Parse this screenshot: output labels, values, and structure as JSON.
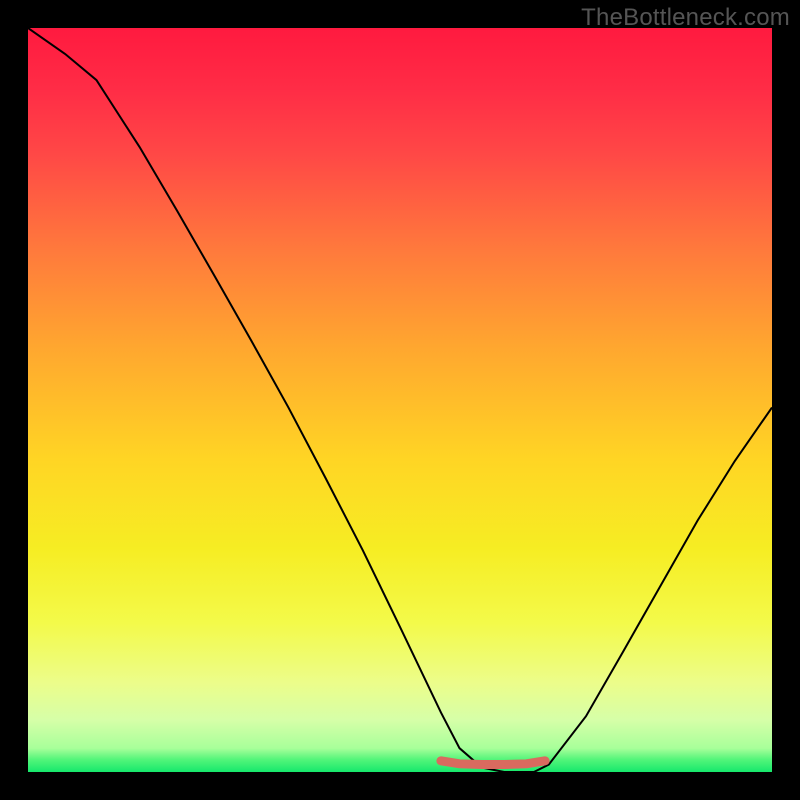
{
  "watermark": "TheBottleneck.com",
  "colors": {
    "gradient_stops": [
      {
        "offset": 0.0,
        "color": "#ff1a3f"
      },
      {
        "offset": 0.085,
        "color": "#ff2d46"
      },
      {
        "offset": 0.17,
        "color": "#ff4846"
      },
      {
        "offset": 0.3,
        "color": "#ff7a3c"
      },
      {
        "offset": 0.43,
        "color": "#ffa72f"
      },
      {
        "offset": 0.58,
        "color": "#ffd524"
      },
      {
        "offset": 0.7,
        "color": "#f6ed23"
      },
      {
        "offset": 0.8,
        "color": "#f3fa4a"
      },
      {
        "offset": 0.88,
        "color": "#ecfd8a"
      },
      {
        "offset": 0.93,
        "color": "#d6ffa8"
      },
      {
        "offset": 0.968,
        "color": "#a8ff9a"
      },
      {
        "offset": 0.983,
        "color": "#54f57a"
      },
      {
        "offset": 1.0,
        "color": "#16e86c"
      }
    ],
    "curve": "#000000",
    "marker": "#d96a5f",
    "frame_bg": "#000000"
  },
  "chart_data": {
    "type": "line",
    "title": "",
    "xlabel": "",
    "ylabel": "",
    "notes": "Bottleneck curve chart. Axes have no visible tick labels. x is normalized 0..1 across width, y is normalized 0..1 (0 = bottom / no bottleneck, 1 = top). Values estimated from pixel positions.",
    "xlim": [
      0,
      1
    ],
    "ylim": [
      0,
      1
    ],
    "series": [
      {
        "name": "bottleneck-curve",
        "x": [
          0.0,
          0.05,
          0.092,
          0.15,
          0.2,
          0.25,
          0.3,
          0.35,
          0.4,
          0.45,
          0.5,
          0.555,
          0.58,
          0.61,
          0.64,
          0.68,
          0.7,
          0.75,
          0.8,
          0.85,
          0.9,
          0.95,
          1.0
        ],
        "y": [
          1.0,
          0.965,
          0.93,
          0.84,
          0.755,
          0.668,
          0.58,
          0.49,
          0.395,
          0.298,
          0.195,
          0.08,
          0.032,
          0.006,
          0.0,
          0.0,
          0.01,
          0.075,
          0.162,
          0.25,
          0.338,
          0.418,
          0.49
        ]
      },
      {
        "name": "optimal-zone-marker",
        "x": [
          0.555,
          0.58,
          0.61,
          0.64,
          0.67,
          0.695
        ],
        "y": [
          0.015,
          0.011,
          0.01,
          0.01,
          0.011,
          0.015
        ]
      }
    ]
  }
}
